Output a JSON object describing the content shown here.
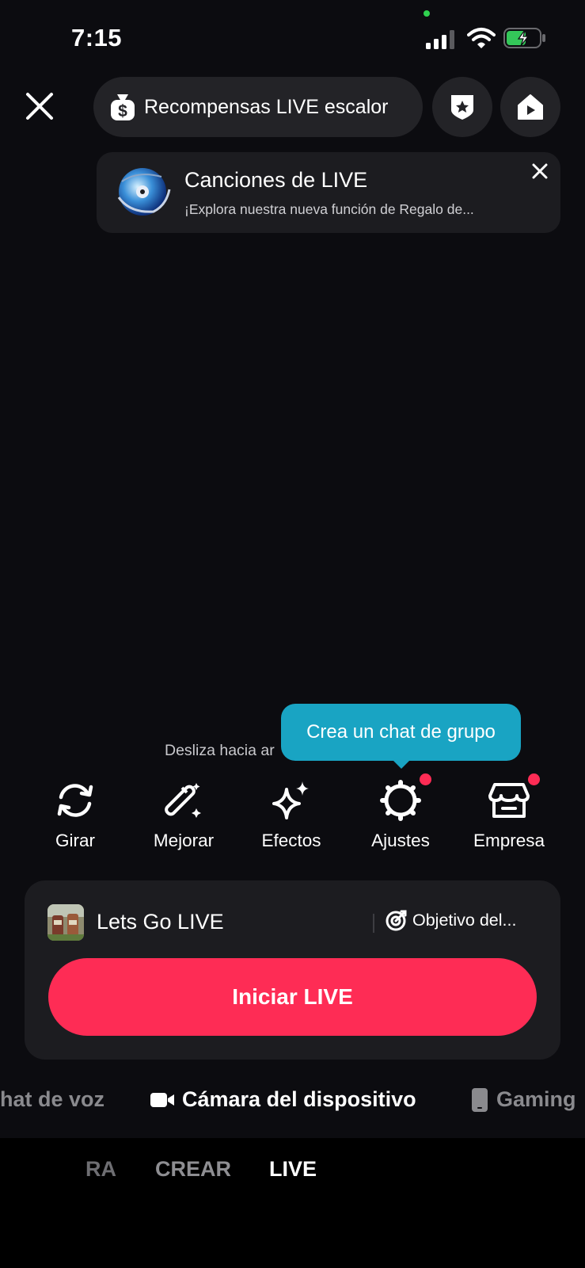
{
  "status": {
    "time": "7:15"
  },
  "header": {
    "rewards_label": "Recompensas LIVE escalor"
  },
  "banner": {
    "title": "Canciones de LIVE",
    "subtitle": "¡Explora nuestra nueva función de Regalo de..."
  },
  "swipe_hint": "Desliza hacia ar",
  "tooltip": "Crea un chat de grupo",
  "tools": [
    {
      "label": "Girar",
      "icon": "flip-camera-icon",
      "dot": false
    },
    {
      "label": "Mejorar",
      "icon": "magic-wand-icon",
      "dot": false
    },
    {
      "label": "Efectos",
      "icon": "sparkles-icon",
      "dot": false
    },
    {
      "label": "Ajustes",
      "icon": "gear-icon",
      "dot": true
    },
    {
      "label": "Empresa",
      "icon": "store-icon",
      "dot": true
    }
  ],
  "card": {
    "live_title": "Lets Go LIVE",
    "goal_label": "Objetivo del...",
    "start_button": "Iniciar LIVE"
  },
  "modes": [
    {
      "label": "hat de voz",
      "selected": false
    },
    {
      "label": "Cámara del dispositivo",
      "selected": true,
      "icon": "video-camera-icon"
    },
    {
      "label": "Gaming",
      "selected": false,
      "icon": "phone-icon"
    }
  ],
  "bottom_tabs": [
    {
      "label": "RA",
      "selected": false
    },
    {
      "label": "CREAR",
      "selected": false
    },
    {
      "label": "LIVE",
      "selected": true
    }
  ],
  "colors": {
    "accent": "#fe2c55",
    "tooltip": "#19a4c3",
    "battery": "#34c759"
  }
}
